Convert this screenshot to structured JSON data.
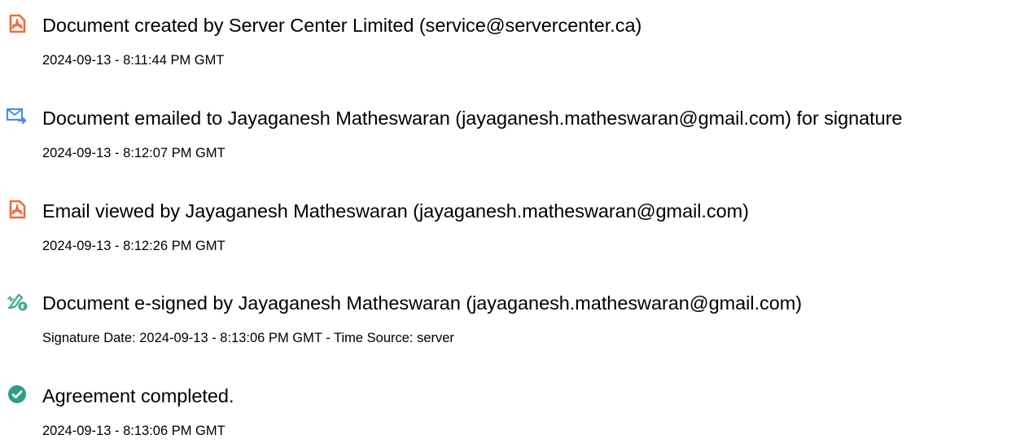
{
  "events": [
    {
      "icon": "document-icon",
      "title": "Document created by Server Center Limited (service@servercenter.ca)",
      "detail": "2024-09-13 - 8:11:44 PM GMT"
    },
    {
      "icon": "email-icon",
      "title": "Document emailed to Jayaganesh Matheswaran (jayaganesh.matheswaran@gmail.com) for signature",
      "detail": "2024-09-13 - 8:12:07 PM GMT"
    },
    {
      "icon": "document-icon",
      "title": "Email viewed by Jayaganesh Matheswaran (jayaganesh.matheswaran@gmail.com)",
      "detail": "2024-09-13 - 8:12:26 PM GMT"
    },
    {
      "icon": "pen-signature-icon",
      "title": "Document e-signed by Jayaganesh Matheswaran (jayaganesh.matheswaran@gmail.com)",
      "detail": "Signature Date: 2024-09-13 - 8:13:06 PM GMT - Time Source: server"
    },
    {
      "icon": "check-circle-icon",
      "title": "Agreement completed.",
      "detail": "2024-09-13 - 8:13:06 PM GMT"
    }
  ],
  "colors": {
    "document_icon": "#F26B3A",
    "email_icon": "#4A8FD9",
    "pen_icon": "#3DAE7A",
    "check_icon": "#2E9E8B"
  }
}
